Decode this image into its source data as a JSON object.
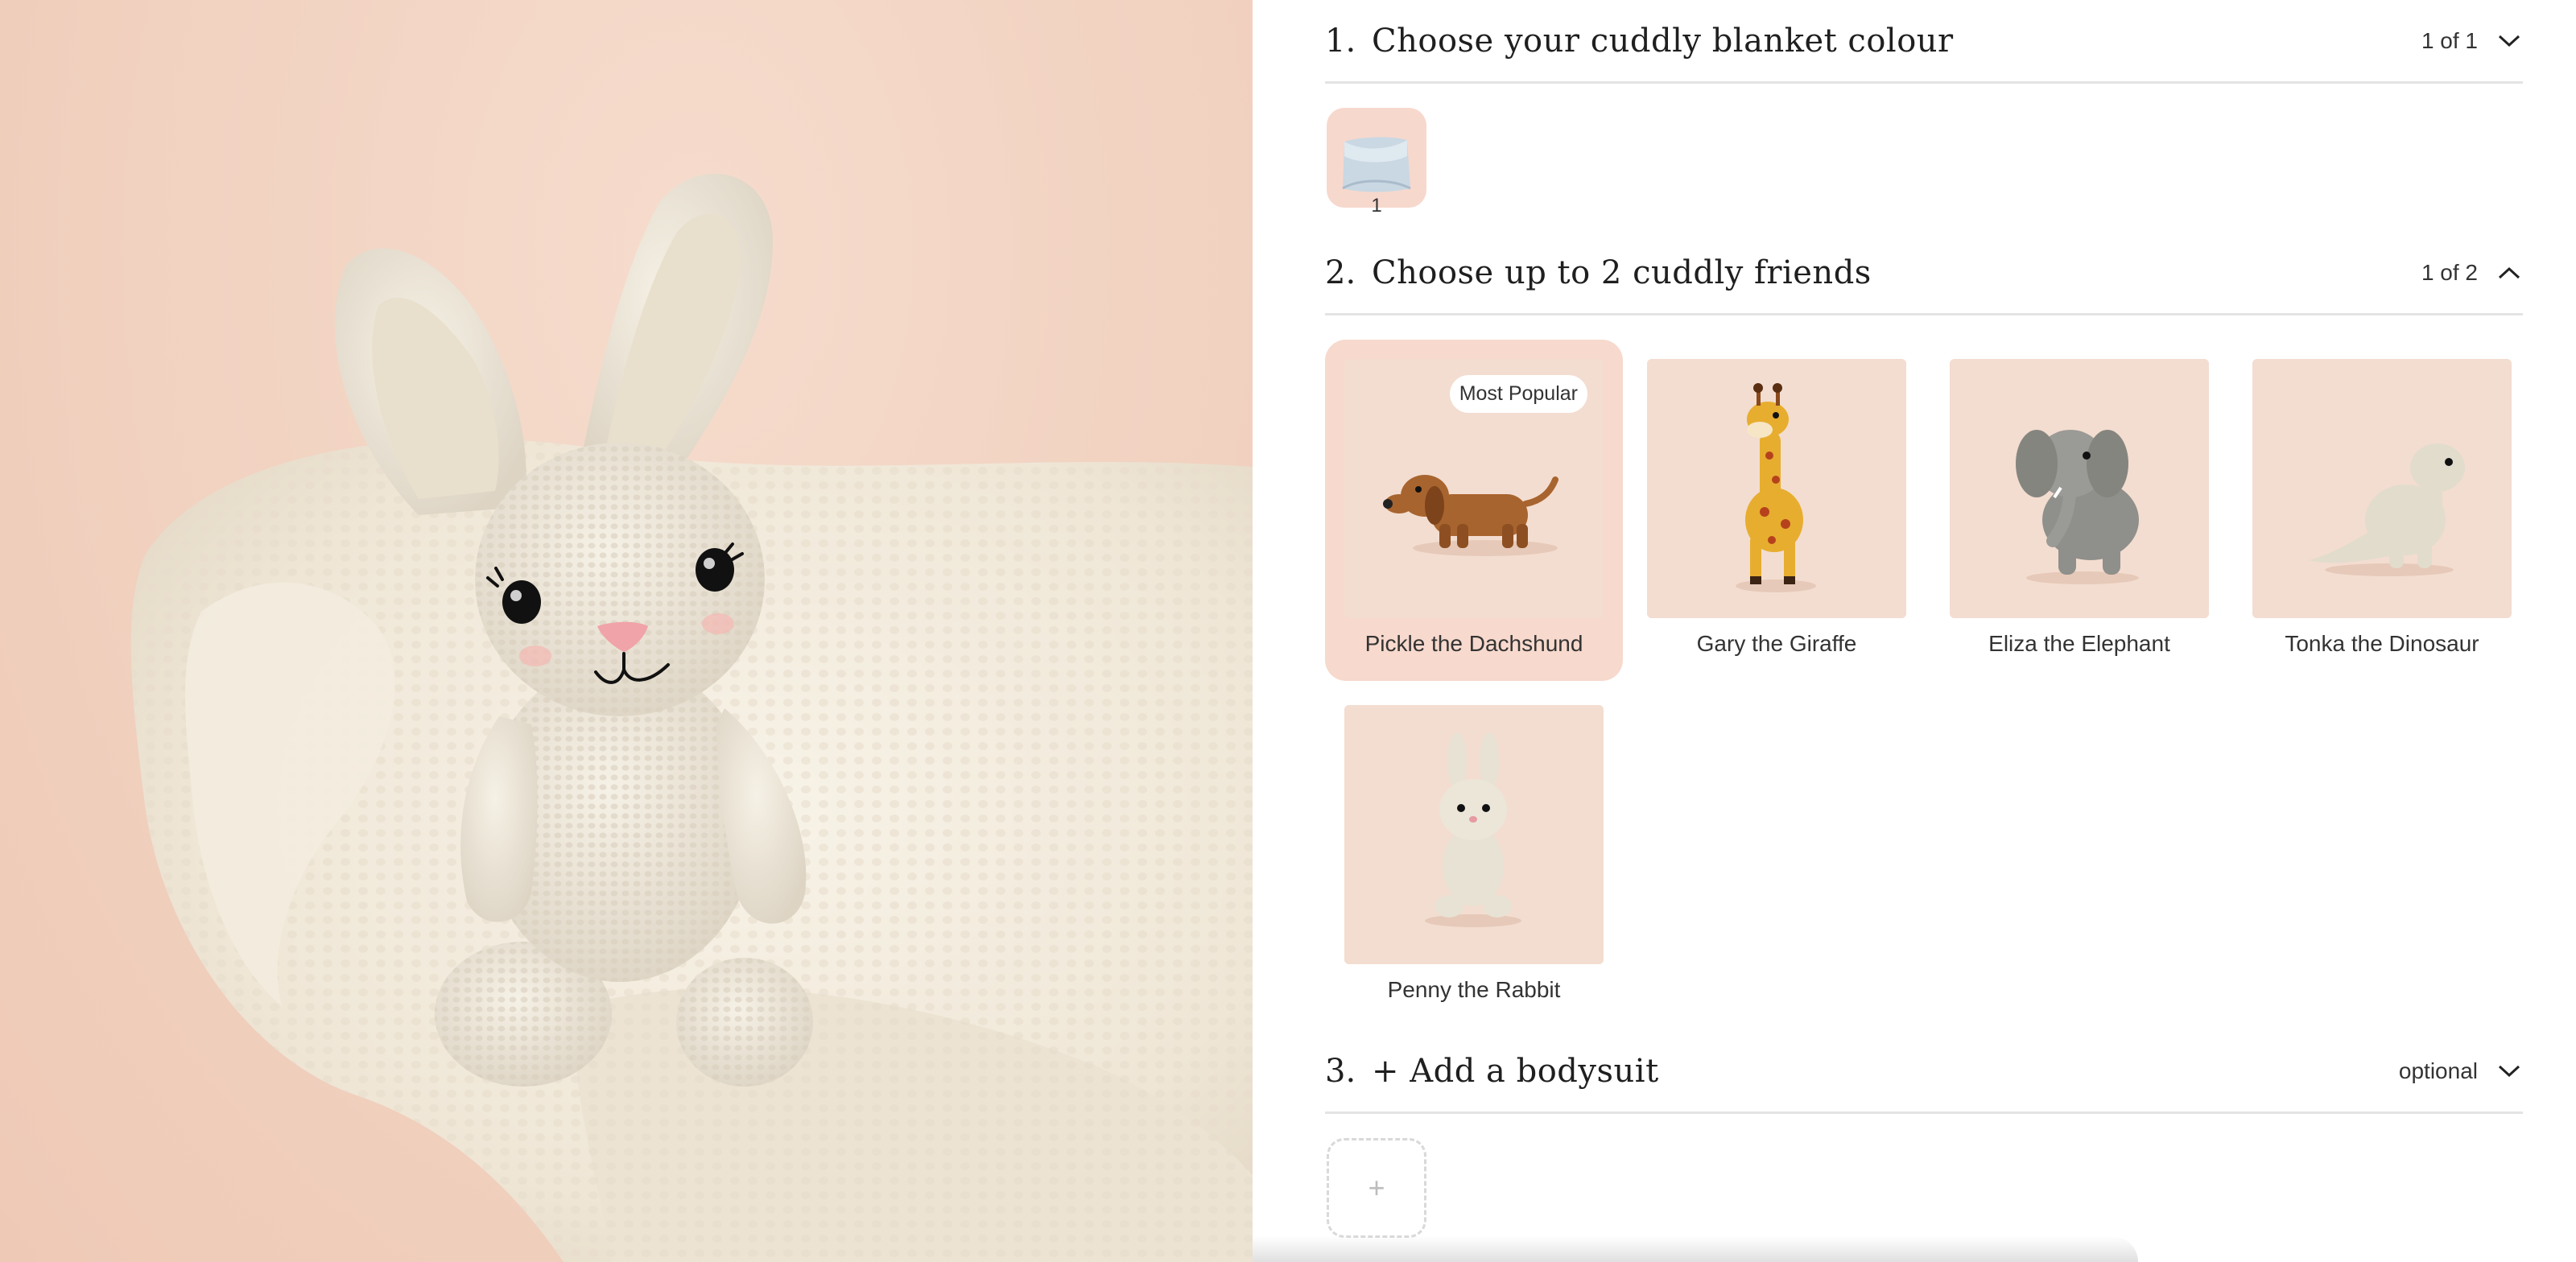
{
  "hero": {
    "icon": "crochet-bunny-photo"
  },
  "steps": [
    {
      "number": "1.",
      "title": "Choose your cuddly blanket colour",
      "status": "1 of 1",
      "chevron": "chevron-down-icon"
    },
    {
      "number": "2.",
      "title": "Choose up to 2 cuddly friends",
      "status": "1 of 2",
      "chevron": "chevron-up-icon"
    },
    {
      "number": "3.",
      "title": "+ Add a bodysuit",
      "status": "optional",
      "chevron": "chevron-down-icon"
    }
  ],
  "blanket": {
    "quantity": "1",
    "color": "#c9d8e3"
  },
  "friends": [
    {
      "name": "Pickle the Dachshund",
      "badge": "Most Popular",
      "selected": true
    },
    {
      "name": "Gary the Giraffe",
      "selected": false
    },
    {
      "name": "Eliza the Elephant",
      "selected": false
    },
    {
      "name": "Tonka the Dinosaur",
      "selected": false
    },
    {
      "name": "Penny the Rabbit",
      "selected": false
    }
  ],
  "bodysuit": {
    "add_symbol": "+"
  },
  "colors": {
    "accent_selected": "#f7d9cd",
    "thumb_bg": "#f1d8cb",
    "divider": "#e4e4e4"
  }
}
